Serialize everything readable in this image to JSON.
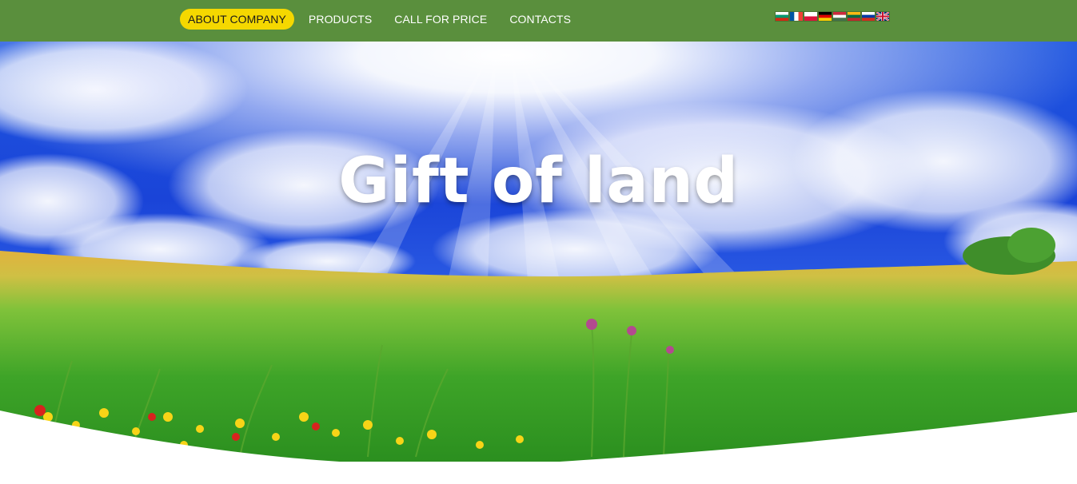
{
  "nav": {
    "items": [
      {
        "label": "ABOUT COMPANY",
        "active": true
      },
      {
        "label": "PRODUCTS",
        "active": false
      },
      {
        "label": "CALL FOR PRICE",
        "active": false
      },
      {
        "label": "CONTACTS",
        "active": false
      }
    ]
  },
  "languages": [
    {
      "code": "bg",
      "icon": "bulgaria-flag-icon"
    },
    {
      "code": "fr",
      "icon": "france-flag-icon"
    },
    {
      "code": "pl",
      "icon": "poland-flag-icon"
    },
    {
      "code": "de",
      "icon": "germany-flag-icon"
    },
    {
      "code": "hu",
      "icon": "hungary-flag-icon"
    },
    {
      "code": "lt",
      "icon": "lithuania-flag-icon"
    },
    {
      "code": "ru",
      "icon": "russia-flag-icon"
    },
    {
      "code": "en",
      "icon": "united-kingdom-flag-icon"
    }
  ],
  "hero": {
    "title": "Gift of land",
    "image": "sunny-meadow-with-wildflowers-under-blue-sky"
  },
  "colors": {
    "header_bg": "#5a8f3d",
    "active_nav_bg": "#f5d800",
    "nav_text": "#ffffff",
    "active_nav_text": "#1a1a1a"
  }
}
